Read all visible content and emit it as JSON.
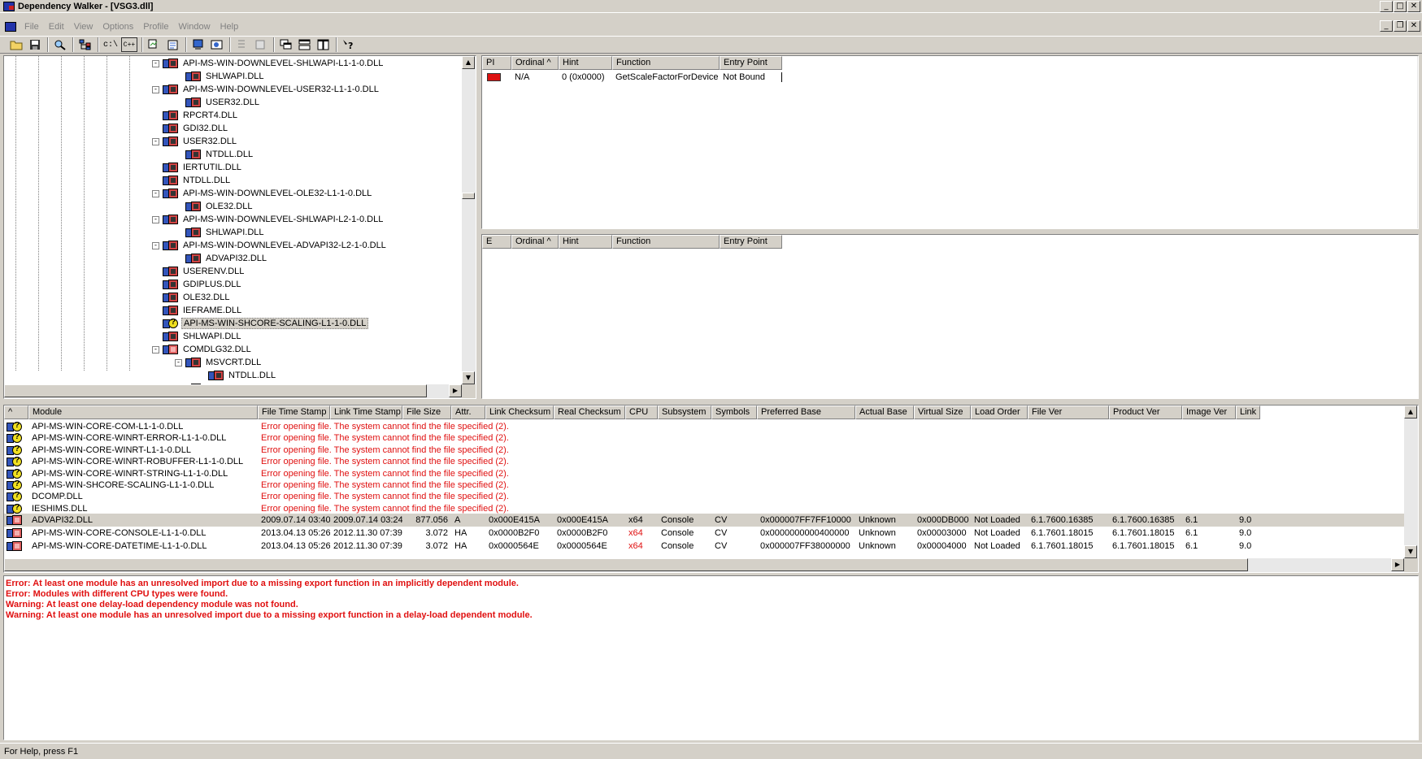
{
  "window": {
    "title": "Dependency Walker - [VSG3.dll]",
    "min": "_",
    "max": "□",
    "close": "✕",
    "restore": "❐"
  },
  "menu": [
    "File",
    "Edit",
    "View",
    "Options",
    "Profile",
    "Window",
    "Help"
  ],
  "toolbar": {
    "buttons": [
      "open-icon",
      "save-icon",
      "find-icon",
      "tree-icon",
      "c-path-icon",
      "cpp-icon",
      "copy-icon",
      "properties-icon",
      "system-info-icon",
      "highlight-icon",
      "match-icon",
      "select-all-icon",
      "cascade-icon",
      "tile-horizontal-icon",
      "tile-vertical-icon",
      "help-icon"
    ],
    "labels": {
      "c_path": "c:\\",
      "cpp": "C++"
    }
  },
  "tree": {
    "rows": [
      {
        "label": "API-MS-WIN-DOWNLEVEL-SHLWAPI-L1-1-0.DLL",
        "level": 0,
        "expand": "-",
        "icon": "normal"
      },
      {
        "label": "SHLWAPI.DLL",
        "level": 1,
        "expand": "",
        "icon": "normal"
      },
      {
        "label": "API-MS-WIN-DOWNLEVEL-USER32-L1-1-0.DLL",
        "level": 0,
        "expand": "-",
        "icon": "normal"
      },
      {
        "label": "USER32.DLL",
        "level": 1,
        "expand": "",
        "icon": "normal"
      },
      {
        "label": "RPCRT4.DLL",
        "level": 0,
        "expand": "",
        "icon": "normal"
      },
      {
        "label": "GDI32.DLL",
        "level": 0,
        "expand": "",
        "icon": "normal"
      },
      {
        "label": "USER32.DLL",
        "level": 0,
        "expand": "-",
        "icon": "normal"
      },
      {
        "label": "NTDLL.DLL",
        "level": 1,
        "expand": "",
        "icon": "normal"
      },
      {
        "label": "IERTUTIL.DLL",
        "level": 0,
        "expand": "",
        "icon": "normal"
      },
      {
        "label": "NTDLL.DLL",
        "level": 0,
        "expand": "",
        "icon": "normal"
      },
      {
        "label": "API-MS-WIN-DOWNLEVEL-OLE32-L1-1-0.DLL",
        "level": 0,
        "expand": "-",
        "icon": "normal"
      },
      {
        "label": "OLE32.DLL",
        "level": 1,
        "expand": "",
        "icon": "normal"
      },
      {
        "label": "API-MS-WIN-DOWNLEVEL-SHLWAPI-L2-1-0.DLL",
        "level": 0,
        "expand": "-",
        "icon": "normal"
      },
      {
        "label": "SHLWAPI.DLL",
        "level": 1,
        "expand": "",
        "icon": "normal"
      },
      {
        "label": "API-MS-WIN-DOWNLEVEL-ADVAPI32-L2-1-0.DLL",
        "level": 0,
        "expand": "-",
        "icon": "normal"
      },
      {
        "label": "ADVAPI32.DLL",
        "level": 1,
        "expand": "",
        "icon": "normal"
      },
      {
        "label": "USERENV.DLL",
        "level": 0,
        "expand": "",
        "icon": "normal"
      },
      {
        "label": "GDIPLUS.DLL",
        "level": 0,
        "expand": "",
        "icon": "normal"
      },
      {
        "label": "OLE32.DLL",
        "level": 0,
        "expand": "",
        "icon": "normal"
      },
      {
        "label": "IEFRAME.DLL",
        "level": 0,
        "expand": "",
        "icon": "normal"
      },
      {
        "label": "API-MS-WIN-SHCORE-SCALING-L1-1-0.DLL",
        "level": 0,
        "expand": "",
        "icon": "missing",
        "selected": true
      },
      {
        "label": "SHLWAPI.DLL",
        "level": 0,
        "expand": "",
        "icon": "normal"
      },
      {
        "label": "COMDLG32.DLL",
        "level": 0,
        "expand": "-",
        "icon": "error"
      },
      {
        "label": "MSVCRT.DLL",
        "level": 1,
        "expand": "-",
        "icon": "normal"
      },
      {
        "label": "NTDLL.DLL",
        "level": 2,
        "expand": "",
        "icon": "normal"
      },
      {
        "label": "NTDLL.DLL",
        "level": 1,
        "expand": "",
        "icon": "normal"
      }
    ]
  },
  "imports": {
    "headers": [
      "PI",
      "Ordinal ^",
      "Hint",
      "Function",
      "Entry Point"
    ],
    "rows": [
      {
        "ordinal": "N/A",
        "hint": "0 (0x0000)",
        "function": "GetScaleFactorForDevice",
        "entry": "Not Bound"
      }
    ]
  },
  "exports": {
    "headers": [
      "E",
      "Ordinal ^",
      "Hint",
      "Function",
      "Entry Point"
    ]
  },
  "modules": {
    "headers": [
      "^",
      "Module",
      "File Time Stamp",
      "Link Time Stamp",
      "File Size",
      "Attr.",
      "Link Checksum",
      "Real Checksum",
      "CPU",
      "Subsystem",
      "Symbols",
      "Preferred Base",
      "Actual Base",
      "Virtual Size",
      "Load Order",
      "File Ver",
      "Product Ver",
      "Image Ver",
      "Link"
    ],
    "missing_rows": [
      {
        "module": "API-MS-WIN-CORE-COM-L1-1-0.DLL",
        "error": "Error opening file. The system cannot find the file specified (2)."
      },
      {
        "module": "API-MS-WIN-CORE-WINRT-ERROR-L1-1-0.DLL",
        "error": "Error opening file. The system cannot find the file specified (2)."
      },
      {
        "module": "API-MS-WIN-CORE-WINRT-L1-1-0.DLL",
        "error": "Error opening file. The system cannot find the file specified (2)."
      },
      {
        "module": "API-MS-WIN-CORE-WINRT-ROBUFFER-L1-1-0.DLL",
        "error": "Error opening file. The system cannot find the file specified (2)."
      },
      {
        "module": "API-MS-WIN-CORE-WINRT-STRING-L1-1-0.DLL",
        "error": "Error opening file. The system cannot find the file specified (2)."
      },
      {
        "module": "API-MS-WIN-SHCORE-SCALING-L1-1-0.DLL",
        "error": "Error opening file. The system cannot find the file specified (2)."
      },
      {
        "module": "DCOMP.DLL",
        "error": "Error opening file. The system cannot find the file specified (2)."
      },
      {
        "module": "IESHIMS.DLL",
        "error": "Error opening file. The system cannot find the file specified (2)."
      }
    ],
    "data_rows": [
      {
        "module": "ADVAPI32.DLL",
        "fts": "2009.07.14 03:40",
        "lts": "2009.07.14 03:24",
        "size": "877.056",
        "attr": "A",
        "lchk": "0x000E415A",
        "rchk": "0x000E415A",
        "cpu": "x64",
        "cpu_red": false,
        "sub": "Console",
        "sym": "CV",
        "pbase": "0x000007FF7FF10000",
        "abase": "Unknown",
        "vsize": "0x000DB000",
        "order": "Not Loaded",
        "fver": "6.1.7600.16385",
        "pver": "6.1.7600.16385",
        "iver": "6.1",
        "link": "9.0",
        "selected": true
      },
      {
        "module": "API-MS-WIN-CORE-CONSOLE-L1-1-0.DLL",
        "fts": "2013.04.13 05:26",
        "lts": "2012.11.30 07:39",
        "size": "3.072",
        "attr": "HA",
        "lchk": "0x0000B2F0",
        "rchk": "0x0000B2F0",
        "cpu": "x64",
        "cpu_red": true,
        "sub": "Console",
        "sym": "CV",
        "pbase": "0x0000000000400000",
        "abase": "Unknown",
        "vsize": "0x00003000",
        "order": "Not Loaded",
        "fver": "6.1.7601.18015",
        "pver": "6.1.7601.18015",
        "iver": "6.1",
        "link": "9.0"
      },
      {
        "module": "API-MS-WIN-CORE-DATETIME-L1-1-0.DLL",
        "fts": "2013.04.13 05:26",
        "lts": "2012.11.30 07:39",
        "size": "3.072",
        "attr": "HA",
        "lchk": "0x0000564E",
        "rchk": "0x0000564E",
        "cpu": "x64",
        "cpu_red": true,
        "sub": "Console",
        "sym": "CV",
        "pbase": "0x000007FF38000000",
        "abase": "Unknown",
        "vsize": "0x00004000",
        "order": "Not Loaded",
        "fver": "6.1.7601.18015",
        "pver": "6.1.7601.18015",
        "iver": "6.1",
        "link": "9.0"
      }
    ]
  },
  "log": [
    "Error: At least one module has an unresolved import due to a missing export function in an implicitly dependent module.",
    "Error: Modules with different CPU types were found.",
    "Warning: At least one delay-load dependency module was not found.",
    "Warning: At least one module has an unresolved import due to a missing export function in a delay-load dependent module."
  ],
  "status": "For Help, press F1",
  "colors": {
    "error_text": "#e01010",
    "chrome": "#d4d0c8",
    "module_icon_blue": "#3355bb",
    "module_icon_red": "#d24444",
    "missing_icon_yellow": "#f0e020"
  }
}
